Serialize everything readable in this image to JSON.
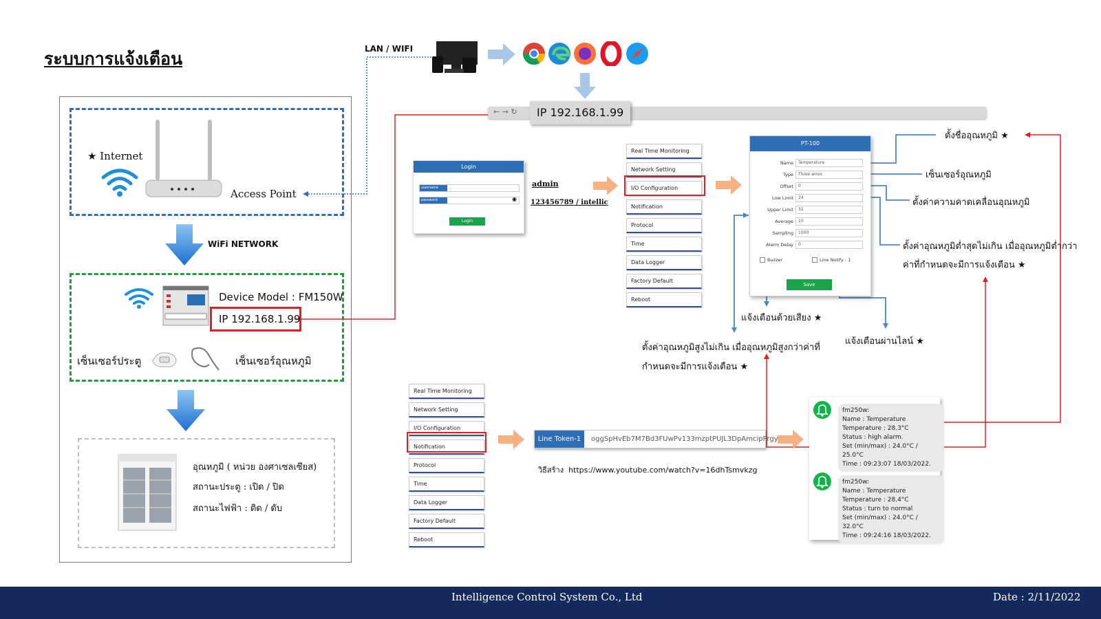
{
  "title": "ระบบการแจ้งเตือน",
  "network": {
    "lan_wifi": "LAN / WIFI",
    "wifi_network": "WiFi NETWORK"
  },
  "access_box": {
    "internet": "Internet",
    "access_point": "Access Point"
  },
  "device_box": {
    "model": "Device Model : FM150W",
    "ip": "IP 192.168.1.99",
    "door_sensor": "เซ็นเซอร์ประตู",
    "temp_sensor": "เซ็นเซอร์อุณหภูมิ"
  },
  "fridge_box": {
    "line1": "อุณหภูมิ  ( หน่วย องศาเซลเซียส)",
    "line2": "สถานะประตู  : เปิด / ปิด",
    "line3": "สถานะไฟฟ้า  : ติด / ดับ"
  },
  "browser": {
    "ip": "IP 192.168.1.99",
    "nav": "←  →  ↻"
  },
  "login": {
    "header": "Login",
    "username_label": "username",
    "password_label": "password",
    "button": "Login",
    "user": "admin",
    "pass": "123456789  / intellic"
  },
  "menu_items": [
    "Real Time Monitoring",
    "Network Setting",
    "I/O Configuration",
    "Notification",
    "Protocol",
    "Time",
    "Data Logger",
    "Factory Default",
    "Reboot"
  ],
  "pt_form": {
    "header": "PT-100",
    "rows": [
      {
        "label": "Name",
        "value": "Temperature"
      },
      {
        "label": "Type",
        "value": "Three wires"
      },
      {
        "label": "Offset",
        "value": "0"
      },
      {
        "label": "Low Limit",
        "value": "24"
      },
      {
        "label": "Upper Limit",
        "value": "32"
      },
      {
        "label": "Average",
        "value": "10"
      },
      {
        "label": "Sampling",
        "value": "1000"
      },
      {
        "label": "Alarm Delay",
        "value": "0"
      }
    ],
    "buzzer": "Buzzer",
    "line_notify": "Line Notify - 1",
    "save": "Save"
  },
  "annotations": {
    "sensor_name": "ตั้งชื่ออุณหภูมิ",
    "sensor_type": "เซ็นเซอร์อุณหภูมิ",
    "offset": "ตั้งค่าความคาดเคลื่อนอุณหภูมิ",
    "low_limit_1": "ตั้งค่าอุณหภูมิต่ำสุดไม่เกิน เมื่ออุณหภูมิต่ำกว่า",
    "low_limit_2": "ค่าที่กำหนดจะมีการแจ้งเตือน",
    "buzzer": "แจ้งเตือนด้วยเสียง",
    "line": "แจ้งเตือนผ่านไลน์",
    "upper_1": "ตั้งค่าอุณหภูมิสูงไม่เกิน เมื่ออุณหภูมิสูงกว่าค่าที่",
    "upper_2": "กำหนดจะมีการแจ้งเตือน",
    "star": "★"
  },
  "token": {
    "label": "Line Token-1",
    "value": "oggSpHvEb7M7Bd3FUwPv133mzptPUJL3DpAmcipPrgy"
  },
  "howto": {
    "label": "วิธีสร้าง",
    "url": "https://www.youtube.com/watch?v=16dhTsmvkzg"
  },
  "notifications": [
    {
      "lines": [
        "fm250w:",
        "Name : Temperature",
        "Temperature : 28.3°C",
        "Status : high alarm.",
        "Set (min/max) : 24.0°C / 25.0°C",
        "Time : 09:23:07 18/03/2022."
      ]
    },
    {
      "lines": [
        "fm250w:",
        "Name : Temperature",
        "Temperature : 28.4°C",
        "Status : turn to normal",
        "Set (min/max) : 24.0°C / 32.0°C",
        "Time : 09:24:16 18/03/2022."
      ]
    }
  ],
  "footer": {
    "company": "Intelligence Control System Co., Ltd",
    "date": "Date : 2/11/2022"
  },
  "colors": {
    "blue": "#2f6db5",
    "green": "#1aa34a",
    "red": "#e02020",
    "arrow_blue": "#4a86c8",
    "footer": "#142a5c"
  }
}
